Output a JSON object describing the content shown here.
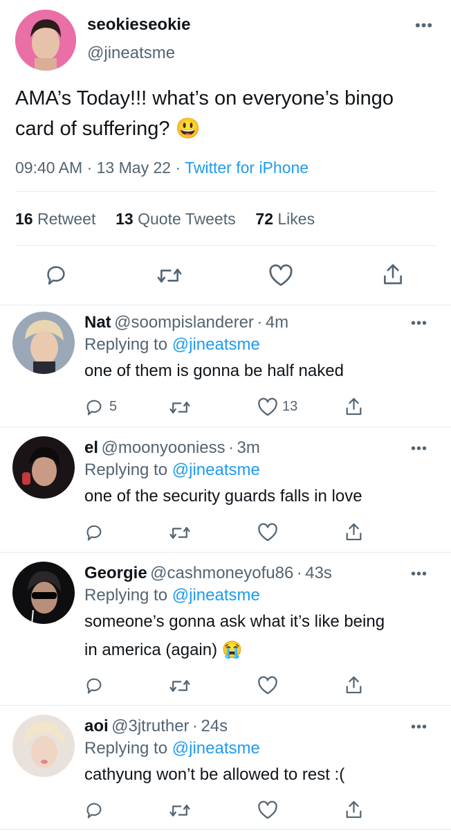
{
  "main_tweet": {
    "display_name": "seokieseokie",
    "handle": "@jineatsme",
    "text": "AMA’s Today!!! what’s on everyone’s bingo card of suffering?",
    "emoji": "😃",
    "time": "09:40 AM",
    "date": "13 May 22",
    "source": "Twitter for iPhone",
    "retweets": "16",
    "retweets_label": "Retweet",
    "quotes": "13",
    "quotes_label": "Quote Tweets",
    "likes": "72",
    "likes_label": "Likes"
  },
  "replies": [
    {
      "name": "Nat",
      "handle": "@soompislanderer",
      "time": "4m",
      "replying_to_label": "Replying to",
      "replying_to": "@jineatsme",
      "text": "one of them is gonna be half naked",
      "reply_count": "5",
      "like_count": "13"
    },
    {
      "name": "el",
      "handle": "@moonyooniess",
      "time": "3m",
      "replying_to_label": "Replying to",
      "replying_to": "@jineatsme",
      "text": "one of the security guards falls in love"
    },
    {
      "name": "Georgie",
      "handle": "@cashmoneyofu86",
      "time": "43s",
      "replying_to_label": "Replying to",
      "replying_to": "@jineatsme",
      "text_line1": "someone’s gonna ask what it’s like being",
      "text_line2": "in america (again)",
      "emoji": "😭"
    },
    {
      "name": "aoi",
      "handle": "@3jtruther",
      "time": "24s",
      "replying_to_label": "Replying to",
      "replying_to": "@jineatsme",
      "text": "cathyung won’t be allowed to rest :("
    }
  ],
  "separator": "·",
  "more_icon": "more-dots-icon",
  "colors": {
    "accent": "#1d9bf0",
    "muted": "#536471",
    "text": "#0f1419"
  }
}
